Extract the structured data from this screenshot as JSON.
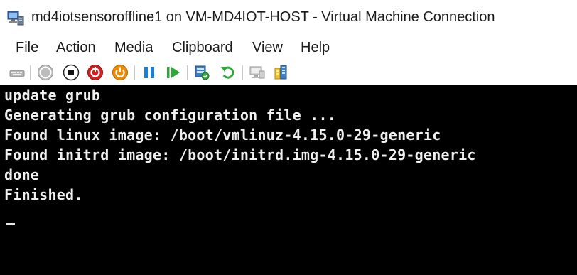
{
  "window": {
    "title": "md4iotsensoroffline1 on VM-MD4IOT-HOST - Virtual Machine Connection"
  },
  "menu": {
    "items": [
      "File",
      "Action",
      "Media",
      "Clipboard",
      "View",
      "Help"
    ]
  },
  "toolbar": {
    "buttons": [
      "ctrl-alt-del-icon",
      "start-icon",
      "turn-off-icon",
      "shut-down-icon",
      "power-icon",
      "pause-icon",
      "resume-icon",
      "checkpoint-icon",
      "revert-icon",
      "enhanced-session-icon",
      "share-icon"
    ]
  },
  "console": {
    "lines": [
      "update grub",
      "Generating grub configuration file ...",
      "Found linux image: /boot/vmlinuz-4.15.0-29-generic",
      "Found initrd image: /boot/initrd.img-4.15.0-29-generic",
      "done",
      "Finished."
    ],
    "cursor": "_"
  },
  "colors": {
    "console_bg": "#000000",
    "console_fg": "#f0f0f0",
    "pause_blue": "#1e7fd6",
    "resume_green": "#2fa83a",
    "stop_red": "#d21f1f",
    "power_orange": "#f08a00"
  }
}
